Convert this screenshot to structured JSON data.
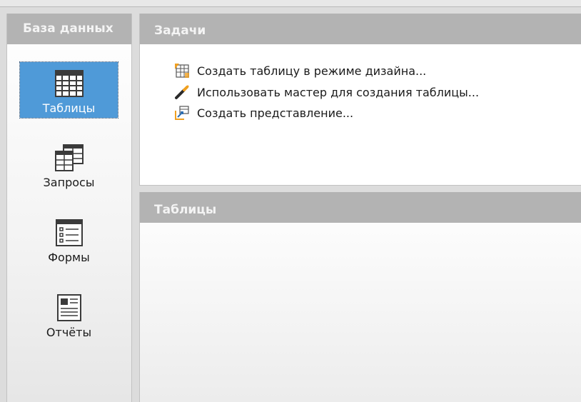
{
  "db_panel": {
    "title": "База данных",
    "items": [
      {
        "label": "Таблицы",
        "icon": "table-icon",
        "selected": true
      },
      {
        "label": "Запросы",
        "icon": "query-icon",
        "selected": false
      },
      {
        "label": "Формы",
        "icon": "form-icon",
        "selected": false
      },
      {
        "label": "Отчёты",
        "icon": "report-icon",
        "selected": false
      }
    ]
  },
  "tasks": {
    "title": "Задачи",
    "items": [
      {
        "label": "Создать таблицу в режиме дизайна...",
        "icon": "design-table-icon"
      },
      {
        "label": "Использовать мастер для создания таблицы...",
        "icon": "wizard-wand-icon"
      },
      {
        "label": "Создать представление...",
        "icon": "create-view-icon"
      }
    ]
  },
  "tables": {
    "title": "Таблицы"
  },
  "colors": {
    "selection": "#4f9ad8",
    "header": "#b3b3b3"
  }
}
